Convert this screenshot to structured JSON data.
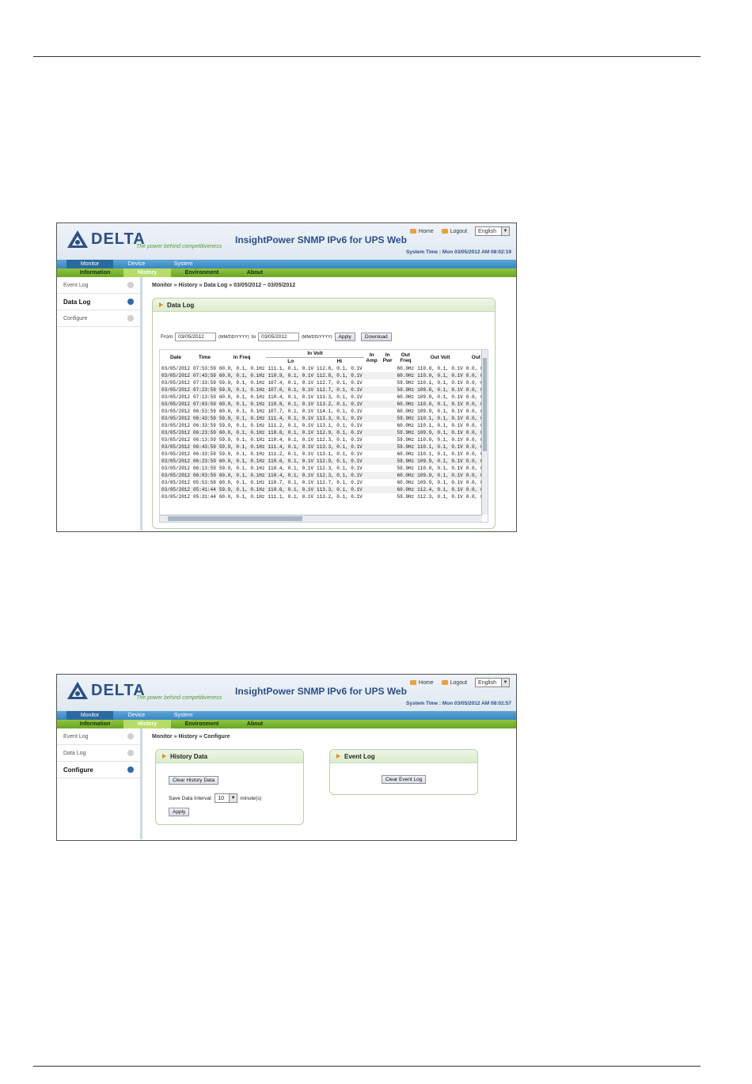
{
  "header": {
    "logo_text": "DELTA",
    "tagline": "The power behind competitiveness",
    "app_title": "InsightPower SNMP IPv6 for UPS Web",
    "links": {
      "home": "Home",
      "logout": "Logout"
    },
    "language": "English"
  },
  "nav": {
    "primary": [
      "Monitor",
      "Device",
      "System"
    ],
    "secondary": [
      "Information",
      "History",
      "Environment",
      "About"
    ]
  },
  "screen1": {
    "system_time": "System Time : Mon 03/05/2012 AM 08:02:19",
    "sidebar": [
      "Event Log",
      "Data Log",
      "Configure"
    ],
    "breadcrumb": "Monitor » History » Data Log  » 03/05/2012 ~ 03/05/2012",
    "panel_title": "Data Log",
    "from_label": "From",
    "from_value": "03/05/2012",
    "format_hint": "(MM/DD/YYYY)",
    "to_label": "to",
    "to_value": "03/05/2012",
    "apply_label": "Apply",
    "download_label": "Download",
    "columns": {
      "date": "Date",
      "time": "Time",
      "in_freq": "In Freq",
      "in_volt": "In Volt",
      "lo": "Lo",
      "hi": "Hi",
      "in_amp": "In Amp",
      "in_pwr": "In Pwr",
      "out_freq": "Out Freq",
      "out_volt": "Out Volt",
      "out": "Out"
    },
    "rows": [
      [
        "03/05/2012",
        "07:53:59",
        "60.0, 0.1, 0.1Hz",
        "111.1, 0.1, 0.1V",
        "112.8, 0.1, 0.1V",
        "60.0Hz",
        "110.0, 0.1, 0.1V",
        "0.0, 0."
      ],
      [
        "03/05/2012",
        "07:43:59",
        "60.0, 0.1, 0.1Hz",
        "110.9, 0.1, 0.1V",
        "112.8, 0.1, 0.1V",
        "60.0Hz",
        "110.0, 0.1, 0.1V",
        "0.0, 0."
      ],
      [
        "03/05/2012",
        "07:33:59",
        "59.9, 0.1, 0.1Hz",
        "107.4, 0.1, 0.1V",
        "112.7, 0.1, 0.1V",
        "59.9Hz",
        "110.1, 0.1, 0.1V",
        "0.0, 0."
      ],
      [
        "03/05/2012",
        "07:23:59",
        "59.9, 0.1, 0.1Hz",
        "107.0, 0.1, 0.1V",
        "112.7, 0.1, 0.1V",
        "59.9Hz",
        "109.8, 0.1, 0.1V",
        "0.0, 0."
      ],
      [
        "03/05/2012",
        "07:13:59",
        "60.0, 0.1, 0.1Hz",
        "110.4, 0.1, 0.1V",
        "113.3, 0.1, 0.1V",
        "60.0Hz",
        "109.8, 0.1, 0.1V",
        "0.0, 0."
      ],
      [
        "03/05/2012",
        "07:03:59",
        "60.0, 0.1, 0.1Hz",
        "110.8, 0.1, 0.1V",
        "113.2, 0.1, 0.1V",
        "60.0Hz",
        "110.0, 0.1, 0.1V",
        "0.0, 0."
      ],
      [
        "03/05/2012",
        "06:53:59",
        "60.0, 0.1, 0.1Hz",
        "107.7, 0.1, 0.1V",
        "114.1, 0.1, 0.1V",
        "60.0Hz",
        "109.9, 0.1, 0.1V",
        "0.0, 0."
      ],
      [
        "03/05/2012",
        "06:43:59",
        "59.9, 0.1, 0.1Hz",
        "111.4, 0.1, 0.1V",
        "113.3, 0.1, 0.1V",
        "59.9Hz",
        "110.1, 0.1, 0.1V",
        "0.0, 0."
      ],
      [
        "03/05/2012",
        "06:33:59",
        "59.9, 0.1, 0.1Hz",
        "111.2, 0.1, 0.1V",
        "113.1, 0.1, 0.1V",
        "60.0Hz",
        "110.1, 0.1, 0.1V",
        "0.0, 0."
      ],
      [
        "03/05/2012",
        "06:23:59",
        "60.0, 0.1, 0.1Hz",
        "110.6, 0.1, 0.1V",
        "112.9, 0.1, 0.1V",
        "59.9Hz",
        "109.9, 0.1, 0.1V",
        "0.0, 0."
      ],
      [
        "03/05/2012",
        "06:13:59",
        "59.9, 0.1, 0.1Hz",
        "110.4, 0.1, 0.1V",
        "112.3, 0.1, 0.1V",
        "59.9Hz",
        "110.0, 0.1, 0.1V",
        "0.0, 0."
      ],
      [
        "03/05/2012",
        "06:43:59",
        "59.9, 0.1, 0.1Hz",
        "111.4, 0.1, 0.1V",
        "113.3, 0.1, 0.1V",
        "59.9Hz",
        "110.1, 0.1, 0.1V",
        "0.0, 0."
      ],
      [
        "03/05/2012",
        "06:33:59",
        "59.9, 0.1, 0.1Hz",
        "111.2, 0.1, 0.1V",
        "113.1, 0.1, 0.1V",
        "60.0Hz",
        "110.1, 0.1, 0.1V",
        "0.0, 0."
      ],
      [
        "03/05/2012",
        "06:23:59",
        "60.0, 0.1, 0.1Hz",
        "110.6, 0.1, 0.1V",
        "112.9, 0.1, 0.1V",
        "59.9Hz",
        "109.9, 0.1, 0.1V",
        "0.0, 0."
      ],
      [
        "03/05/2012",
        "06:13:59",
        "59.9, 0.1, 0.1Hz",
        "110.4, 0.1, 0.1V",
        "112.3, 0.1, 0.1V",
        "59.9Hz",
        "110.0, 0.1, 0.1V",
        "0.0, 0."
      ],
      [
        "03/05/2012",
        "06:03:59",
        "60.0, 0.1, 0.1Hz",
        "110.4, 0.1, 0.1V",
        "112.3, 0.1, 0.1V",
        "60.0Hz",
        "109.9, 0.1, 0.1V",
        "0.0, 0."
      ],
      [
        "03/05/2012",
        "05:53:58",
        "60.0, 0.1, 0.1Hz",
        "110.7, 0.1, 0.1V",
        "112.7, 0.1, 0.1V",
        "60.0Hz",
        "109.9, 0.1, 0.1V",
        "0.0, 0."
      ],
      [
        "03/05/2012",
        "05:41:44",
        "59.9, 0.1, 0.1Hz",
        "110.6, 0.1, 0.1V",
        "113.3, 0.1, 0.1V",
        "60.0Hz",
        "112.4, 0.1, 0.1V",
        "0.0, 0."
      ],
      [
        "03/05/2012",
        "05:31:44",
        "60.0, 0.1, 0.1Hz",
        "111.1, 0.1, 0.1V",
        "113.2, 0.1, 0.1V",
        "59.9Hz",
        "112.3, 0.1, 0.1V",
        "0.0, 0."
      ]
    ]
  },
  "screen2": {
    "system_time": "System Time : Mon 03/05/2012 AM 08:02:57",
    "sidebar": [
      "Event Log",
      "Data Log",
      "Configure"
    ],
    "breadcrumb": "Monitor » History » Configure",
    "history_title": "History Data",
    "clear_history_label": "Clear History Data",
    "interval_label": "Save Data Interval:",
    "interval_value": "10",
    "interval_unit": "minute(s)",
    "apply_label": "Apply",
    "event_title": "Event Log",
    "clear_event_label": "Clear Event Log"
  },
  "colors": {
    "brand_blue": "#2b4f8a",
    "nav_blue": "#3a86c0",
    "nav_green": "#6aa626",
    "accent_orange": "#e88a1a"
  }
}
